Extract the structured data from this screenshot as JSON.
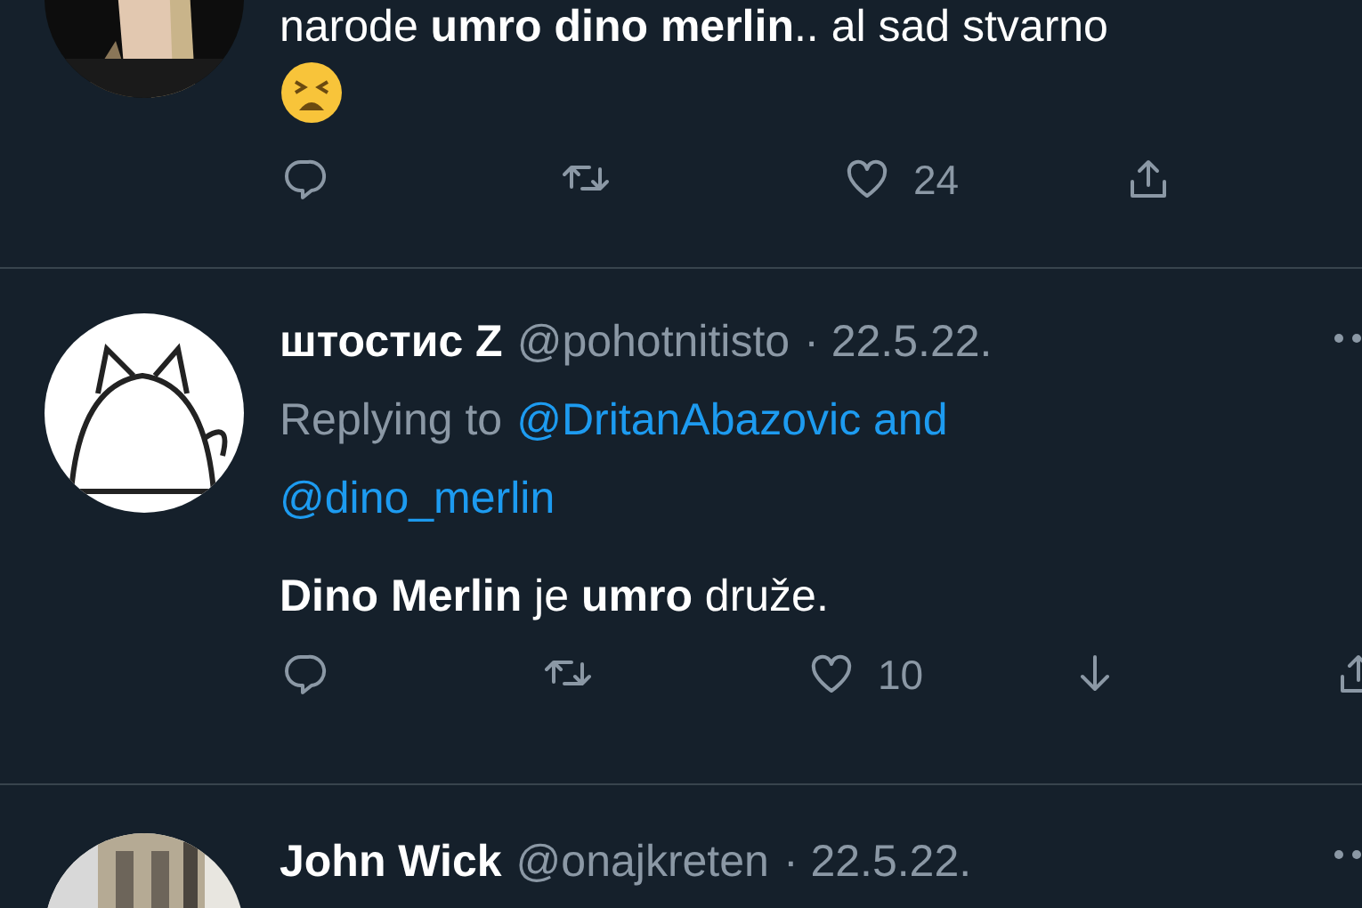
{
  "tweets": [
    {
      "text": "narode **umro dino merlin**.. al sad stvarno",
      "emoji": true,
      "actions": [
        {
          "kind": "reply"
        },
        {
          "kind": "retweet"
        },
        {
          "kind": "like",
          "count": "24"
        },
        {
          "kind": "share"
        }
      ]
    },
    {
      "name": "штостис Z",
      "handle": "@pohotnitisto",
      "date": "· 22.5.22.",
      "replying": {
        "prefix": "Replying to",
        "links": [
          "@DritanAbazovic and",
          "@dino_merlin"
        ]
      },
      "text": "**Dino Merlin** je **umro** druže.",
      "actions": [
        {
          "kind": "reply"
        },
        {
          "kind": "retweet"
        },
        {
          "kind": "like",
          "count": "10"
        },
        {
          "kind": "downvote"
        },
        {
          "kind": "share"
        }
      ]
    },
    {
      "name": "John Wick",
      "handle": "@onajkreten",
      "date": "· 22.5.22."
    }
  ]
}
